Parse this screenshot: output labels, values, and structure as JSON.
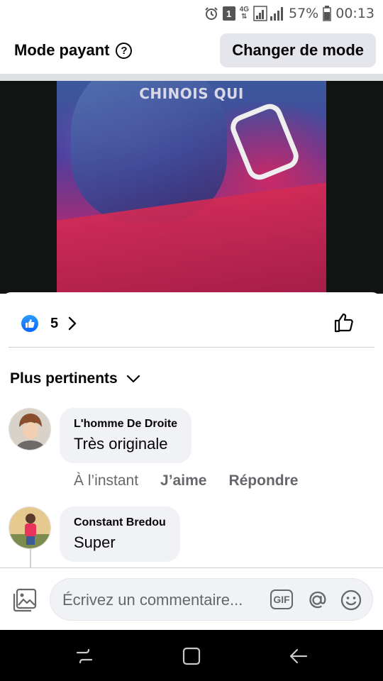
{
  "status_bar": {
    "network": "4G",
    "battery": "57%",
    "time": "00:13",
    "notification_badge": "1"
  },
  "header": {
    "title": "Mode payant",
    "help_icon": "?",
    "change_mode_label": "Changer de mode"
  },
  "video": {
    "caption": "CHINOIS QUI"
  },
  "reactions": {
    "count": "5"
  },
  "sort": {
    "label": "Plus pertinents"
  },
  "comments": [
    {
      "author": "L'homme De Droite",
      "text": "Très originale",
      "time": "À l’instant",
      "like_label": "J’aime",
      "reply_label": "Répondre"
    },
    {
      "author": "Constant Bredou",
      "text": "Super"
    }
  ],
  "composer": {
    "placeholder": "Écrivez un commentaire...",
    "gif_label": "GIF"
  },
  "colors": {
    "brand_blue": "#0866ff",
    "secondary_text": "#65676b",
    "bubble_bg": "#f0f2f5"
  }
}
